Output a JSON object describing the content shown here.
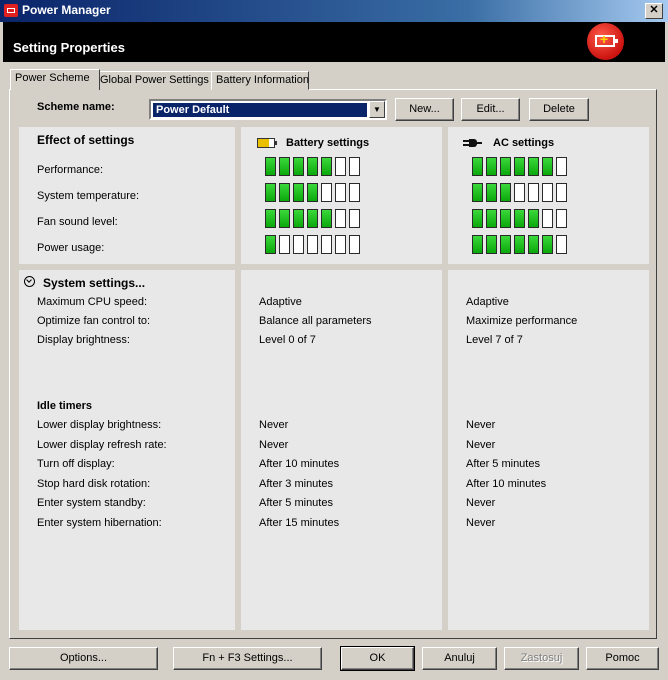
{
  "window": {
    "title": "Power Manager",
    "close": "✕"
  },
  "header": {
    "title": "Setting Properties",
    "logo_icon": "battery-plus-logo-icon"
  },
  "tabs": [
    {
      "label": "Power Scheme"
    },
    {
      "label": "Global Power Settings"
    },
    {
      "label": "Battery Information"
    }
  ],
  "scheme": {
    "label": "Scheme name:",
    "value": "Power Default",
    "buttons": {
      "new": "New...",
      "edit": "Edit...",
      "delete": "Delete"
    }
  },
  "effect": {
    "title": "Effect of settings",
    "battery_title": "Battery settings",
    "ac_title": "AC settings",
    "total_segments": 7,
    "rows": [
      {
        "label": "Performance:",
        "battery": 5,
        "ac": 6
      },
      {
        "label": "System temperature:",
        "battery": 4,
        "ac": 3
      },
      {
        "label": "Fan sound level:",
        "battery": 5,
        "ac": 5
      },
      {
        "label": "Power usage:",
        "battery": 1,
        "ac": 6
      }
    ]
  },
  "system": {
    "title": "System settings...",
    "rows": [
      {
        "label": "Maximum CPU speed:",
        "battery": "Adaptive",
        "ac": "Adaptive"
      },
      {
        "label": "Optimize fan control to:",
        "battery": "Balance all parameters",
        "ac": "Maximize performance"
      },
      {
        "label": "Display brightness:",
        "battery": "Level 0 of 7",
        "ac": "Level 7 of 7"
      }
    ]
  },
  "idle": {
    "title": "Idle timers",
    "rows": [
      {
        "label": "Lower display brightness:",
        "battery": "Never",
        "ac": "Never"
      },
      {
        "label": "Lower display refresh rate:",
        "battery": "Never",
        "ac": "Never"
      },
      {
        "label": "Turn off display:",
        "battery": "After 10 minutes",
        "ac": "After 5 minutes"
      },
      {
        "label": "Stop hard disk rotation:",
        "battery": "After 3 minutes",
        "ac": "After 10 minutes"
      },
      {
        "label": "Enter system standby:",
        "battery": "After 5 minutes",
        "ac": "Never"
      },
      {
        "label": "Enter system hibernation:",
        "battery": "After 15 minutes",
        "ac": "Never"
      }
    ]
  },
  "footer": {
    "options": "Options...",
    "fn_f3": "Fn + F3 Settings...",
    "ok": "OK",
    "cancel": "Anuluj",
    "apply": "Zastosuj",
    "help": "Pomoc"
  }
}
